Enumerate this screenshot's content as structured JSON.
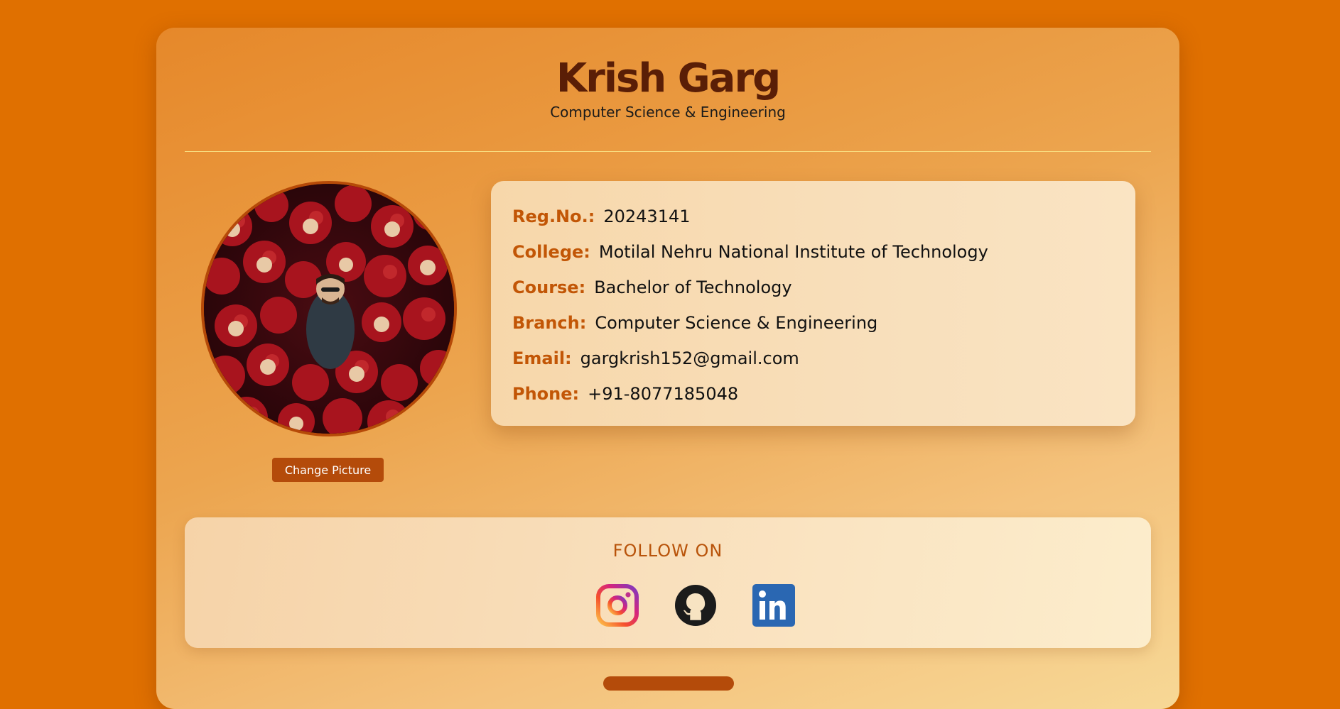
{
  "profile": {
    "name": "Krish Garg",
    "subtitle": "Computer Science & Engineering",
    "change_picture_label": "Change Picture"
  },
  "info": [
    {
      "label": "Reg.No.:",
      "value": "20243141"
    },
    {
      "label": "College:",
      "value": "Motilal Nehru National Institute of Technology"
    },
    {
      "label": "Course:",
      "value": "Bachelor of Technology"
    },
    {
      "label": "Branch:",
      "value": "Computer Science & Engineering"
    },
    {
      "label": "Email:",
      "value": "gargkrish152@gmail.com"
    },
    {
      "label": "Phone:",
      "value": "+91-8077185048"
    }
  ],
  "follow": {
    "title": "FOLLOW ON",
    "links": [
      {
        "icon": "instagram-icon"
      },
      {
        "icon": "github-icon"
      },
      {
        "icon": "linkedin-icon"
      }
    ]
  },
  "colors": {
    "page_background": "#e07000",
    "name": "#5a1e06",
    "label": "#c25606",
    "button": "#b44b0a",
    "divider": "#f8dd80"
  }
}
